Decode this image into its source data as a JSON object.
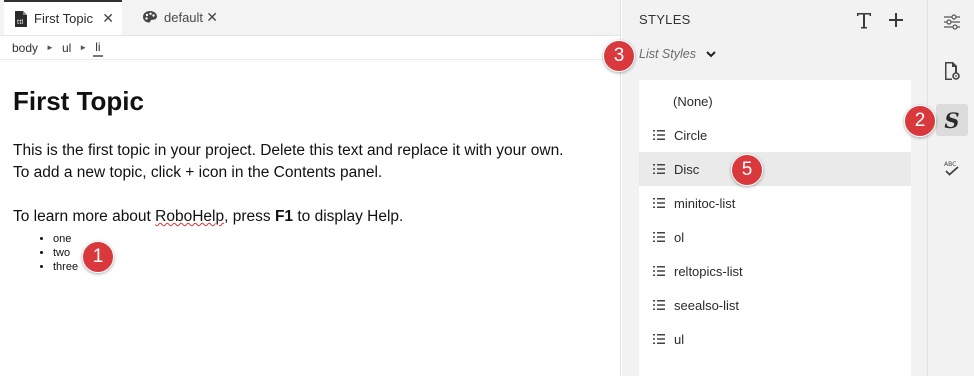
{
  "editor": {
    "tabs": [
      {
        "label": "First Topic",
        "icon": "document-icon"
      },
      {
        "label": "default",
        "icon": "palette-icon"
      }
    ],
    "close_glyph": "✕",
    "breadcrumb": [
      "body",
      "ul",
      "li"
    ],
    "breadcrumb_sep": "►",
    "content": {
      "heading": "First Topic",
      "line1": "This is the first topic in your project. Delete this text and replace it with your own.",
      "line2": "To add a new topic, click + icon in the Contents panel.",
      "help_pre": "To learn more about ",
      "help_word": "RoboHelp",
      "help_mid": ", press ",
      "help_key": "F1",
      "help_post": " to display Help.",
      "list": [
        "one",
        "two",
        "three"
      ]
    }
  },
  "styles_panel": {
    "title": "STYLES",
    "filter_label": "List Styles",
    "items": [
      "(None)",
      "Circle",
      "Disc",
      "minitoc-list",
      "ol",
      "reltopics-list",
      "seealso-list",
      "ul"
    ],
    "selected_item": "Disc"
  },
  "rail": {
    "style_glyph": "S",
    "buttons": [
      "properties-sliders-icon",
      "topic-settings-icon",
      "styles-icon",
      "spellcheck-icon"
    ]
  },
  "callouts": [
    "1",
    "2",
    "3",
    "5"
  ],
  "colors": {
    "callout": "#d9393d",
    "selected_row": "#eaeaea"
  }
}
